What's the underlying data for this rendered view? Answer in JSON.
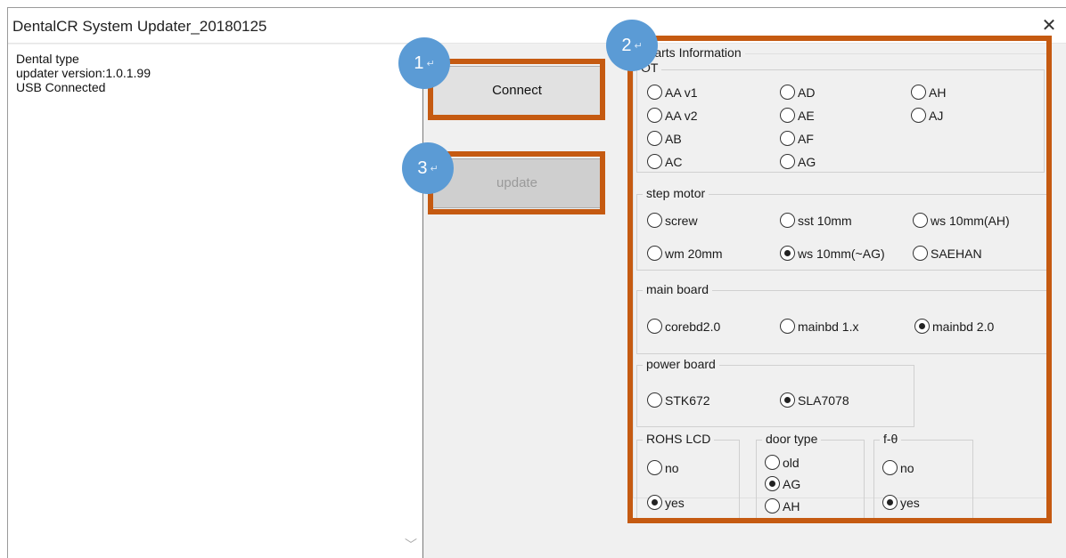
{
  "window": {
    "title": "DentalCR System Updater_20180125",
    "close_glyph": "✕"
  },
  "log": {
    "lines": [
      "Dental type",
      "updater version:1.0.1.99",
      "USB Connected"
    ],
    "scroll_glyph": "﹀"
  },
  "buttons": {
    "connect": "Connect",
    "update": "update"
  },
  "callouts": [
    "1",
    "2",
    "3"
  ],
  "callout_arrow": "↵",
  "colors": {
    "highlight": "#c55a11",
    "callout": "#5b9bd5"
  },
  "parts": {
    "title": "Parts Information",
    "ot": {
      "label": "OT",
      "options": [
        {
          "label": "AA v1",
          "checked": false
        },
        {
          "label": "AD",
          "checked": false
        },
        {
          "label": "AH",
          "checked": false
        },
        {
          "label": "AA v2",
          "checked": false
        },
        {
          "label": "AE",
          "checked": false
        },
        {
          "label": "AJ",
          "checked": false
        },
        {
          "label": "AB",
          "checked": false
        },
        {
          "label": "AF",
          "checked": false
        },
        {
          "label": "AC",
          "checked": false
        },
        {
          "label": "AG",
          "checked": false
        }
      ]
    },
    "step_motor": {
      "label": "step motor",
      "options": [
        {
          "label": "screw",
          "checked": false
        },
        {
          "label": "sst 10mm",
          "checked": false
        },
        {
          "label": "ws 10mm(AH)",
          "checked": false
        },
        {
          "label": "wm 20mm",
          "checked": false
        },
        {
          "label": "ws 10mm(~AG)",
          "checked": true
        },
        {
          "label": "SAEHAN",
          "checked": false
        }
      ]
    },
    "main_board": {
      "label": "main board",
      "options": [
        {
          "label": "corebd2.0",
          "checked": false
        },
        {
          "label": "mainbd 1.x",
          "checked": false
        },
        {
          "label": "mainbd 2.0",
          "checked": true
        }
      ]
    },
    "power_board": {
      "label": "power board",
      "options": [
        {
          "label": "STK672",
          "checked": false
        },
        {
          "label": "SLA7078",
          "checked": true
        }
      ]
    },
    "rohs_lcd": {
      "label": "ROHS LCD",
      "options": [
        {
          "label": "no",
          "checked": false
        },
        {
          "label": "yes",
          "checked": true
        }
      ]
    },
    "door_type": {
      "label": "door type",
      "options": [
        {
          "label": "old",
          "checked": false
        },
        {
          "label": "AG",
          "checked": true
        },
        {
          "label": "AH",
          "checked": false
        }
      ]
    },
    "f_theta": {
      "label": "f-θ",
      "options": [
        {
          "label": "no",
          "checked": false
        },
        {
          "label": "yes",
          "checked": true
        }
      ]
    }
  }
}
